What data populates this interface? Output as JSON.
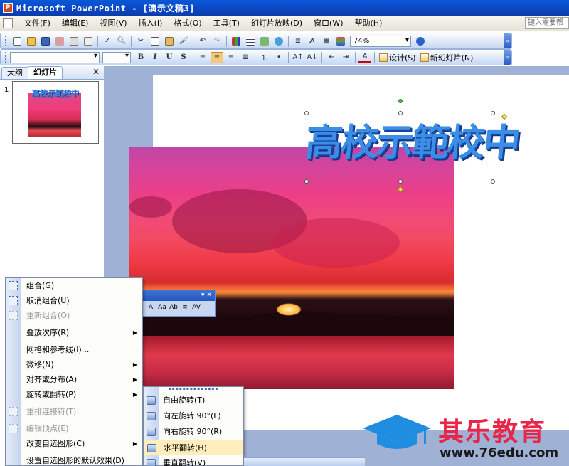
{
  "window": {
    "title": "Microsoft PowerPoint - [演示文稿3]"
  },
  "menubar": {
    "items": [
      "文件(F)",
      "编辑(E)",
      "视图(V)",
      "插入(I)",
      "格式(O)",
      "工具(T)",
      "幻灯片放映(D)",
      "窗口(W)",
      "帮助(H)"
    ],
    "help_placeholder": "键入需要帮"
  },
  "toolbar": {
    "zoom": "74%",
    "design_label": "设计(S)",
    "new_slide_label": "新幻灯片(N)"
  },
  "left_panel": {
    "tabs": [
      "大纲",
      "幻灯片"
    ],
    "slide_number": "1",
    "thumb_text": "高校示範校中"
  },
  "slide": {
    "wordart_text": "高校示範校中"
  },
  "wordart_toolbar": {
    "buttons": [
      "A",
      "Aa",
      "Ab",
      "≡",
      "AV"
    ]
  },
  "context_menu": {
    "items": [
      {
        "label": "组合(G)",
        "disabled": false
      },
      {
        "label": "取消组合(U)",
        "disabled": false
      },
      {
        "label": "重新组合(O)",
        "disabled": true
      },
      {
        "label": "叠放次序(R)",
        "disabled": false,
        "submenu": true
      },
      {
        "label": "网格和参考线(I)...",
        "disabled": false
      },
      {
        "label": "微移(N)",
        "disabled": false,
        "submenu": true
      },
      {
        "label": "对齐或分布(A)",
        "disabled": false,
        "submenu": true
      },
      {
        "label": "旋转或翻转(P)",
        "disabled": false,
        "submenu": true
      },
      {
        "label": "重排连接符(T)",
        "disabled": true
      },
      {
        "label": "编辑顶点(E)",
        "disabled": true
      },
      {
        "label": "改变自选图形(C)",
        "disabled": false,
        "submenu": true
      },
      {
        "label": "设置自选图形的默认效果(D)",
        "disabled": false
      }
    ]
  },
  "rotate_submenu": {
    "items": [
      {
        "label": "自由旋转(T)"
      },
      {
        "label": "向左旋转 90°(L)"
      },
      {
        "label": "向右旋转 90°(R)"
      },
      {
        "label": "水平翻转(H)",
        "highlighted": true
      },
      {
        "label": "垂直翻转(V)"
      }
    ]
  },
  "watermark": {
    "brand": "其乐教育",
    "url": "www.76edu.com"
  },
  "colors": {
    "title_bar": "#0b46c2",
    "accent": "#e8264a",
    "wordart": "#3b8de6"
  }
}
